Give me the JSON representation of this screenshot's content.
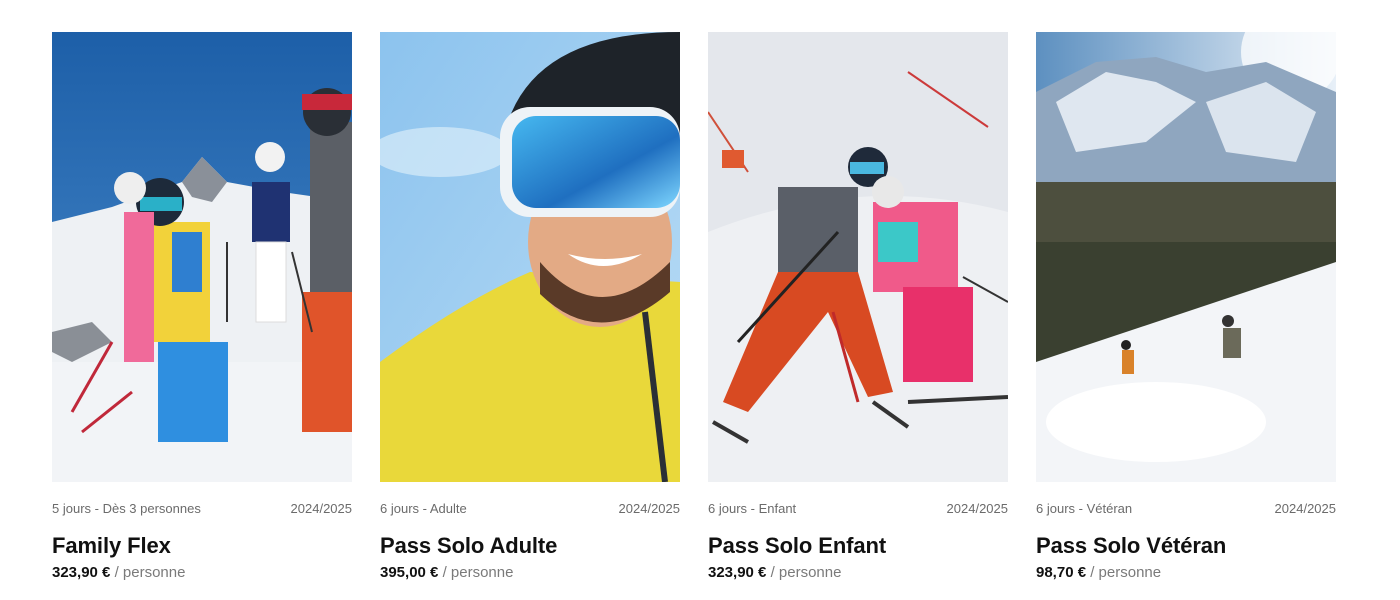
{
  "season": "2024/2025",
  "currency": "€",
  "per_label": "/ personne",
  "passes": [
    {
      "details": "5 jours - Dès 3 personnes",
      "season": "2024/2025",
      "title": "Family Flex",
      "price": "323,90 €",
      "unit": "/ personne",
      "image": "family-skiers-photo"
    },
    {
      "details": "6 jours - Adulte",
      "season": "2024/2025",
      "title": "Pass Solo Adulte",
      "price": "395,00 €",
      "unit": "/ personne",
      "image": "smiling-skier-goggles-photo"
    },
    {
      "details": "6 jours - Enfant",
      "season": "2024/2025",
      "title": "Pass Solo Enfant",
      "price": "323,90 €",
      "unit": "/ personne",
      "image": "father-child-skiing-photo"
    },
    {
      "details": "6 jours - Vétéran",
      "season": "2024/2025",
      "title": "Pass Solo Vétéran",
      "price": "98,70 €",
      "unit": "/ personne",
      "image": "skiers-on-slope-photo"
    }
  ]
}
